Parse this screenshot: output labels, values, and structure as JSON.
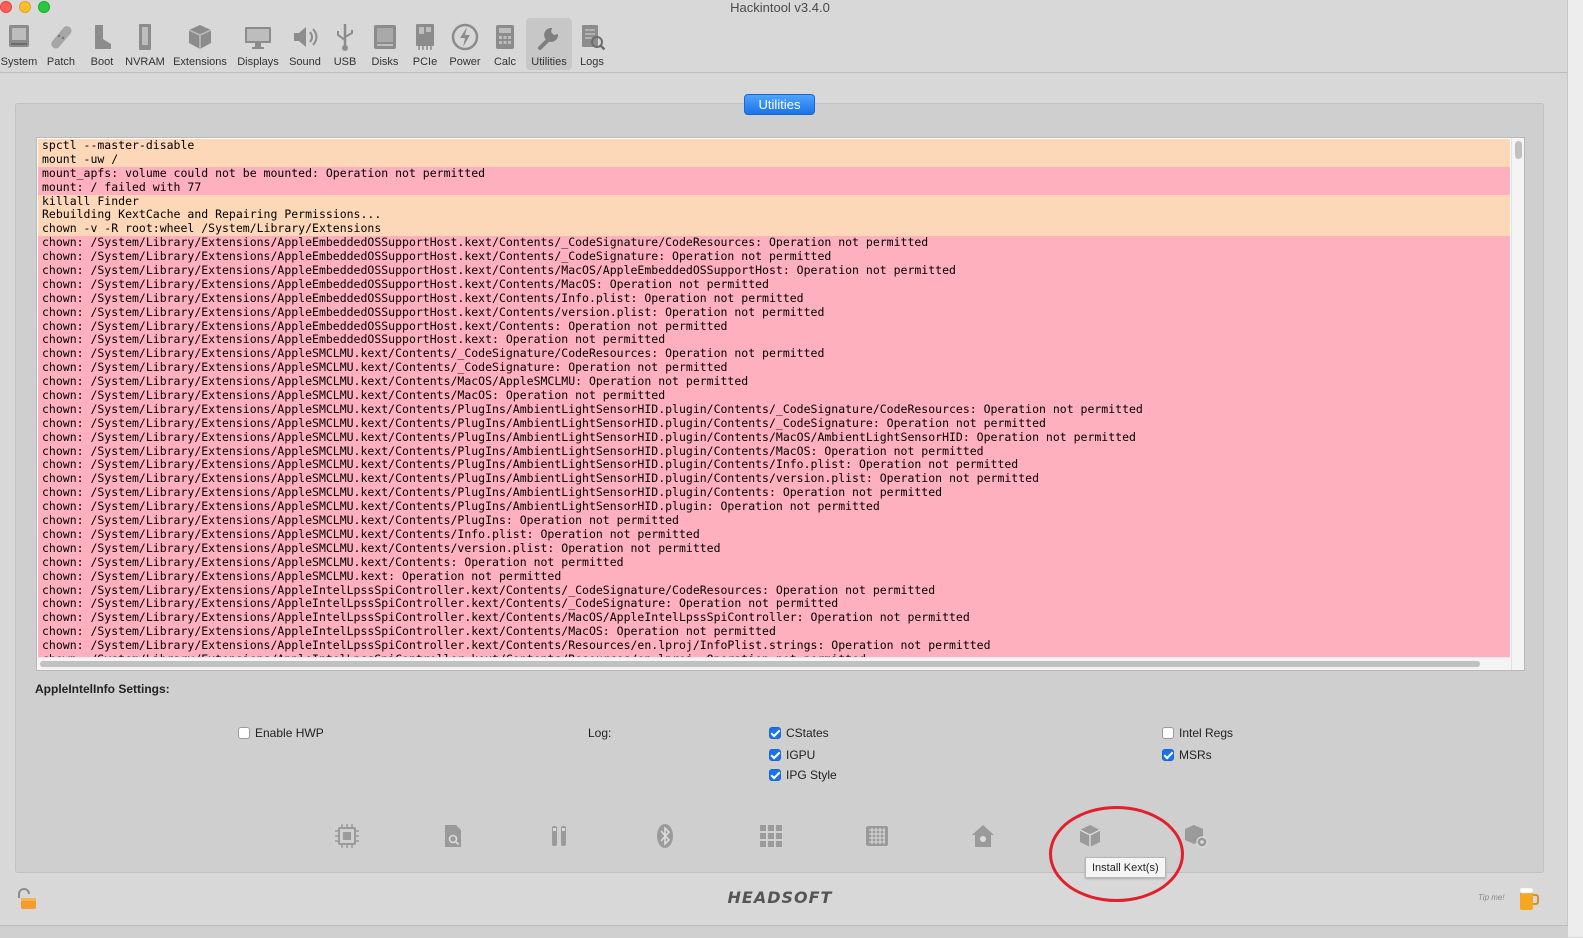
{
  "window": {
    "title": "Hackintool v3.4.0"
  },
  "toolbar": {
    "items": [
      {
        "label": "System",
        "icon": "system-icon"
      },
      {
        "label": "Patch",
        "icon": "patch-icon"
      },
      {
        "label": "Boot",
        "icon": "boot-icon"
      },
      {
        "label": "NVRAM",
        "icon": "nvram-icon"
      },
      {
        "label": "Extensions",
        "icon": "extensions-icon"
      },
      {
        "label": "Displays",
        "icon": "displays-icon"
      },
      {
        "label": "Sound",
        "icon": "sound-icon"
      },
      {
        "label": "USB",
        "icon": "usb-icon"
      },
      {
        "label": "Disks",
        "icon": "disks-icon"
      },
      {
        "label": "PCIe",
        "icon": "pcie-icon"
      },
      {
        "label": "Power",
        "icon": "power-icon"
      },
      {
        "label": "Calc",
        "icon": "calc-icon"
      },
      {
        "label": "Utilities",
        "icon": "utilities-icon"
      },
      {
        "label": "Logs",
        "icon": "logs-icon"
      }
    ],
    "active": "Utilities"
  },
  "section": {
    "button_label": "Utilities"
  },
  "console": {
    "lines": [
      {
        "text": "spctl --master-disable",
        "kind": "peach"
      },
      {
        "text": "mount -uw /",
        "kind": "peach"
      },
      {
        "text": "mount_apfs: volume could not be mounted: Operation not permitted",
        "kind": "pink"
      },
      {
        "text": "mount: / failed with 77",
        "kind": "pink"
      },
      {
        "text": "killall Finder",
        "kind": "peach"
      },
      {
        "text": "Rebuilding KextCache and Repairing Permissions...",
        "kind": "peach"
      },
      {
        "text": "chown -v -R root:wheel /System/Library/Extensions",
        "kind": "peach"
      },
      {
        "text": "chown: /System/Library/Extensions/AppleEmbeddedOSSupportHost.kext/Contents/_CodeSignature/CodeResources: Operation not permitted",
        "kind": "pink"
      },
      {
        "text": "chown: /System/Library/Extensions/AppleEmbeddedOSSupportHost.kext/Contents/_CodeSignature: Operation not permitted",
        "kind": "pink"
      },
      {
        "text": "chown: /System/Library/Extensions/AppleEmbeddedOSSupportHost.kext/Contents/MacOS/AppleEmbeddedOSSupportHost: Operation not permitted",
        "kind": "pink"
      },
      {
        "text": "chown: /System/Library/Extensions/AppleEmbeddedOSSupportHost.kext/Contents/MacOS: Operation not permitted",
        "kind": "pink"
      },
      {
        "text": "chown: /System/Library/Extensions/AppleEmbeddedOSSupportHost.kext/Contents/Info.plist: Operation not permitted",
        "kind": "pink"
      },
      {
        "text": "chown: /System/Library/Extensions/AppleEmbeddedOSSupportHost.kext/Contents/version.plist: Operation not permitted",
        "kind": "pink"
      },
      {
        "text": "chown: /System/Library/Extensions/AppleEmbeddedOSSupportHost.kext/Contents: Operation not permitted",
        "kind": "pink"
      },
      {
        "text": "chown: /System/Library/Extensions/AppleEmbeddedOSSupportHost.kext: Operation not permitted",
        "kind": "pink"
      },
      {
        "text": "chown: /System/Library/Extensions/AppleSMCLMU.kext/Contents/_CodeSignature/CodeResources: Operation not permitted",
        "kind": "pink"
      },
      {
        "text": "chown: /System/Library/Extensions/AppleSMCLMU.kext/Contents/_CodeSignature: Operation not permitted",
        "kind": "pink"
      },
      {
        "text": "chown: /System/Library/Extensions/AppleSMCLMU.kext/Contents/MacOS/AppleSMCLMU: Operation not permitted",
        "kind": "pink"
      },
      {
        "text": "chown: /System/Library/Extensions/AppleSMCLMU.kext/Contents/MacOS: Operation not permitted",
        "kind": "pink"
      },
      {
        "text": "chown: /System/Library/Extensions/AppleSMCLMU.kext/Contents/PlugIns/AmbientLightSensorHID.plugin/Contents/_CodeSignature/CodeResources: Operation not permitted",
        "kind": "pink"
      },
      {
        "text": "chown: /System/Library/Extensions/AppleSMCLMU.kext/Contents/PlugIns/AmbientLightSensorHID.plugin/Contents/_CodeSignature: Operation not permitted",
        "kind": "pink"
      },
      {
        "text": "chown: /System/Library/Extensions/AppleSMCLMU.kext/Contents/PlugIns/AmbientLightSensorHID.plugin/Contents/MacOS/AmbientLightSensorHID: Operation not permitted",
        "kind": "pink"
      },
      {
        "text": "chown: /System/Library/Extensions/AppleSMCLMU.kext/Contents/PlugIns/AmbientLightSensorHID.plugin/Contents/MacOS: Operation not permitted",
        "kind": "pink"
      },
      {
        "text": "chown: /System/Library/Extensions/AppleSMCLMU.kext/Contents/PlugIns/AmbientLightSensorHID.plugin/Contents/Info.plist: Operation not permitted",
        "kind": "pink"
      },
      {
        "text": "chown: /System/Library/Extensions/AppleSMCLMU.kext/Contents/PlugIns/AmbientLightSensorHID.plugin/Contents/version.plist: Operation not permitted",
        "kind": "pink"
      },
      {
        "text": "chown: /System/Library/Extensions/AppleSMCLMU.kext/Contents/PlugIns/AmbientLightSensorHID.plugin/Contents: Operation not permitted",
        "kind": "pink"
      },
      {
        "text": "chown: /System/Library/Extensions/AppleSMCLMU.kext/Contents/PlugIns/AmbientLightSensorHID.plugin: Operation not permitted",
        "kind": "pink"
      },
      {
        "text": "chown: /System/Library/Extensions/AppleSMCLMU.kext/Contents/PlugIns: Operation not permitted",
        "kind": "pink"
      },
      {
        "text": "chown: /System/Library/Extensions/AppleSMCLMU.kext/Contents/Info.plist: Operation not permitted",
        "kind": "pink"
      },
      {
        "text": "chown: /System/Library/Extensions/AppleSMCLMU.kext/Contents/version.plist: Operation not permitted",
        "kind": "pink"
      },
      {
        "text": "chown: /System/Library/Extensions/AppleSMCLMU.kext/Contents: Operation not permitted",
        "kind": "pink"
      },
      {
        "text": "chown: /System/Library/Extensions/AppleSMCLMU.kext: Operation not permitted",
        "kind": "pink"
      },
      {
        "text": "chown: /System/Library/Extensions/AppleIntelLpssSpiController.kext/Contents/_CodeSignature/CodeResources: Operation not permitted",
        "kind": "pink"
      },
      {
        "text": "chown: /System/Library/Extensions/AppleIntelLpssSpiController.kext/Contents/_CodeSignature: Operation not permitted",
        "kind": "pink"
      },
      {
        "text": "chown: /System/Library/Extensions/AppleIntelLpssSpiController.kext/Contents/MacOS/AppleIntelLpssSpiController: Operation not permitted",
        "kind": "pink"
      },
      {
        "text": "chown: /System/Library/Extensions/AppleIntelLpssSpiController.kext/Contents/MacOS: Operation not permitted",
        "kind": "pink"
      },
      {
        "text": "chown: /System/Library/Extensions/AppleIntelLpssSpiController.kext/Contents/Resources/en.lproj/InfoPlist.strings: Operation not permitted",
        "kind": "pink"
      },
      {
        "text": "chown: /System/Library/Extensions/AppleIntelLpssSpiController.kext/Contents/Resources/en.lproj: Operation not permitted",
        "kind": "pink"
      }
    ]
  },
  "settings": {
    "title": "AppleIntelInfo Settings:",
    "enable_hwp": {
      "label": "Enable HWP",
      "checked": false
    },
    "log_label": "Log:",
    "cstates": {
      "label": "CStates",
      "checked": true
    },
    "igpu": {
      "label": "IGPU",
      "checked": true
    },
    "ipg_style": {
      "label": "IPG Style",
      "checked": true
    },
    "intel_regs": {
      "label": "Intel Regs",
      "checked": false
    },
    "msrs": {
      "label": "MSRs",
      "checked": true
    }
  },
  "tools": {
    "icons": [
      "cpu-icon",
      "disk-search-icon",
      "usb-ports-icon",
      "bluetooth-icon",
      "grid-icon",
      "memory-chip-icon",
      "home-icon",
      "install-kext-icon",
      "kext-settings-icon"
    ],
    "tooltip": "Install Kext(s)"
  },
  "footer": {
    "logo": "HEADSOFT",
    "tip_label": "Tip me!"
  },
  "colors": {
    "accent": "#1a73e8",
    "peach": "#fdd8b8",
    "pink": "#feb0bf",
    "highlight_circle": "#e0202a"
  }
}
